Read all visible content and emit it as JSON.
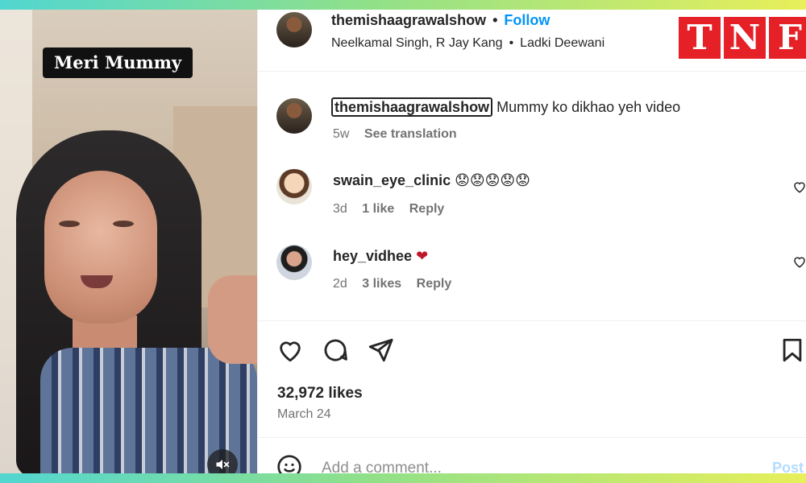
{
  "video": {
    "caption": "Meri Mummy",
    "mute_icon": "muted-speaker-icon"
  },
  "header": {
    "username": "themishaagrawalshow",
    "separator": "•",
    "follow_label": "Follow",
    "audio": "Neelkamal Singh, R Jay Kang",
    "song": "Ladki Deewani"
  },
  "watermark": {
    "letters": [
      "T",
      "N",
      "F"
    ]
  },
  "post_caption": {
    "username": "themishaagrawalshow",
    "text": "Mummy ko dikhao yeh video",
    "age": "5w",
    "see_translation": "See translation"
  },
  "comments": [
    {
      "username": "swain_eye_clinic",
      "text": "😟😟😟😟😟",
      "age": "3d",
      "likes": "1 like",
      "reply": "Reply"
    },
    {
      "username": "hey_vidhee",
      "text": "❤",
      "age": "2d",
      "likes": "3 likes",
      "reply": "Reply"
    }
  ],
  "actions": {
    "like_icon": "heart-icon",
    "comment_icon": "comment-bubble-icon",
    "share_icon": "paper-plane-icon",
    "save_icon": "bookmark-icon"
  },
  "stats": {
    "likes": "32,972 likes",
    "date": "March 24"
  },
  "composer": {
    "placeholder": "Add a comment...",
    "post_label": "Post",
    "emoji_icon": "emoji-smile-icon"
  },
  "colors": {
    "accent": "#0095f6",
    "watermark_red": "#e52127",
    "heart_red": "#c0172b"
  }
}
